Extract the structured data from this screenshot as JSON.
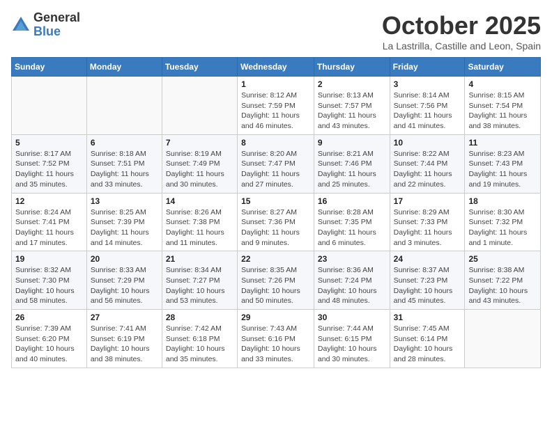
{
  "logo": {
    "general": "General",
    "blue": "Blue"
  },
  "title": "October 2025",
  "location": "La Lastrilla, Castille and Leon, Spain",
  "days_of_week": [
    "Sunday",
    "Monday",
    "Tuesday",
    "Wednesday",
    "Thursday",
    "Friday",
    "Saturday"
  ],
  "weeks": [
    [
      {
        "day": "",
        "info": ""
      },
      {
        "day": "",
        "info": ""
      },
      {
        "day": "",
        "info": ""
      },
      {
        "day": "1",
        "info": "Sunrise: 8:12 AM\nSunset: 7:59 PM\nDaylight: 11 hours\nand 46 minutes."
      },
      {
        "day": "2",
        "info": "Sunrise: 8:13 AM\nSunset: 7:57 PM\nDaylight: 11 hours\nand 43 minutes."
      },
      {
        "day": "3",
        "info": "Sunrise: 8:14 AM\nSunset: 7:56 PM\nDaylight: 11 hours\nand 41 minutes."
      },
      {
        "day": "4",
        "info": "Sunrise: 8:15 AM\nSunset: 7:54 PM\nDaylight: 11 hours\nand 38 minutes."
      }
    ],
    [
      {
        "day": "5",
        "info": "Sunrise: 8:17 AM\nSunset: 7:52 PM\nDaylight: 11 hours\nand 35 minutes."
      },
      {
        "day": "6",
        "info": "Sunrise: 8:18 AM\nSunset: 7:51 PM\nDaylight: 11 hours\nand 33 minutes."
      },
      {
        "day": "7",
        "info": "Sunrise: 8:19 AM\nSunset: 7:49 PM\nDaylight: 11 hours\nand 30 minutes."
      },
      {
        "day": "8",
        "info": "Sunrise: 8:20 AM\nSunset: 7:47 PM\nDaylight: 11 hours\nand 27 minutes."
      },
      {
        "day": "9",
        "info": "Sunrise: 8:21 AM\nSunset: 7:46 PM\nDaylight: 11 hours\nand 25 minutes."
      },
      {
        "day": "10",
        "info": "Sunrise: 8:22 AM\nSunset: 7:44 PM\nDaylight: 11 hours\nand 22 minutes."
      },
      {
        "day": "11",
        "info": "Sunrise: 8:23 AM\nSunset: 7:43 PM\nDaylight: 11 hours\nand 19 minutes."
      }
    ],
    [
      {
        "day": "12",
        "info": "Sunrise: 8:24 AM\nSunset: 7:41 PM\nDaylight: 11 hours\nand 17 minutes."
      },
      {
        "day": "13",
        "info": "Sunrise: 8:25 AM\nSunset: 7:39 PM\nDaylight: 11 hours\nand 14 minutes."
      },
      {
        "day": "14",
        "info": "Sunrise: 8:26 AM\nSunset: 7:38 PM\nDaylight: 11 hours\nand 11 minutes."
      },
      {
        "day": "15",
        "info": "Sunrise: 8:27 AM\nSunset: 7:36 PM\nDaylight: 11 hours\nand 9 minutes."
      },
      {
        "day": "16",
        "info": "Sunrise: 8:28 AM\nSunset: 7:35 PM\nDaylight: 11 hours\nand 6 minutes."
      },
      {
        "day": "17",
        "info": "Sunrise: 8:29 AM\nSunset: 7:33 PM\nDaylight: 11 hours\nand 3 minutes."
      },
      {
        "day": "18",
        "info": "Sunrise: 8:30 AM\nSunset: 7:32 PM\nDaylight: 11 hours\nand 1 minute."
      }
    ],
    [
      {
        "day": "19",
        "info": "Sunrise: 8:32 AM\nSunset: 7:30 PM\nDaylight: 10 hours\nand 58 minutes."
      },
      {
        "day": "20",
        "info": "Sunrise: 8:33 AM\nSunset: 7:29 PM\nDaylight: 10 hours\nand 56 minutes."
      },
      {
        "day": "21",
        "info": "Sunrise: 8:34 AM\nSunset: 7:27 PM\nDaylight: 10 hours\nand 53 minutes."
      },
      {
        "day": "22",
        "info": "Sunrise: 8:35 AM\nSunset: 7:26 PM\nDaylight: 10 hours\nand 50 minutes."
      },
      {
        "day": "23",
        "info": "Sunrise: 8:36 AM\nSunset: 7:24 PM\nDaylight: 10 hours\nand 48 minutes."
      },
      {
        "day": "24",
        "info": "Sunrise: 8:37 AM\nSunset: 7:23 PM\nDaylight: 10 hours\nand 45 minutes."
      },
      {
        "day": "25",
        "info": "Sunrise: 8:38 AM\nSunset: 7:22 PM\nDaylight: 10 hours\nand 43 minutes."
      }
    ],
    [
      {
        "day": "26",
        "info": "Sunrise: 7:39 AM\nSunset: 6:20 PM\nDaylight: 10 hours\nand 40 minutes."
      },
      {
        "day": "27",
        "info": "Sunrise: 7:41 AM\nSunset: 6:19 PM\nDaylight: 10 hours\nand 38 minutes."
      },
      {
        "day": "28",
        "info": "Sunrise: 7:42 AM\nSunset: 6:18 PM\nDaylight: 10 hours\nand 35 minutes."
      },
      {
        "day": "29",
        "info": "Sunrise: 7:43 AM\nSunset: 6:16 PM\nDaylight: 10 hours\nand 33 minutes."
      },
      {
        "day": "30",
        "info": "Sunrise: 7:44 AM\nSunset: 6:15 PM\nDaylight: 10 hours\nand 30 minutes."
      },
      {
        "day": "31",
        "info": "Sunrise: 7:45 AM\nSunset: 6:14 PM\nDaylight: 10 hours\nand 28 minutes."
      },
      {
        "day": "",
        "info": ""
      }
    ]
  ]
}
